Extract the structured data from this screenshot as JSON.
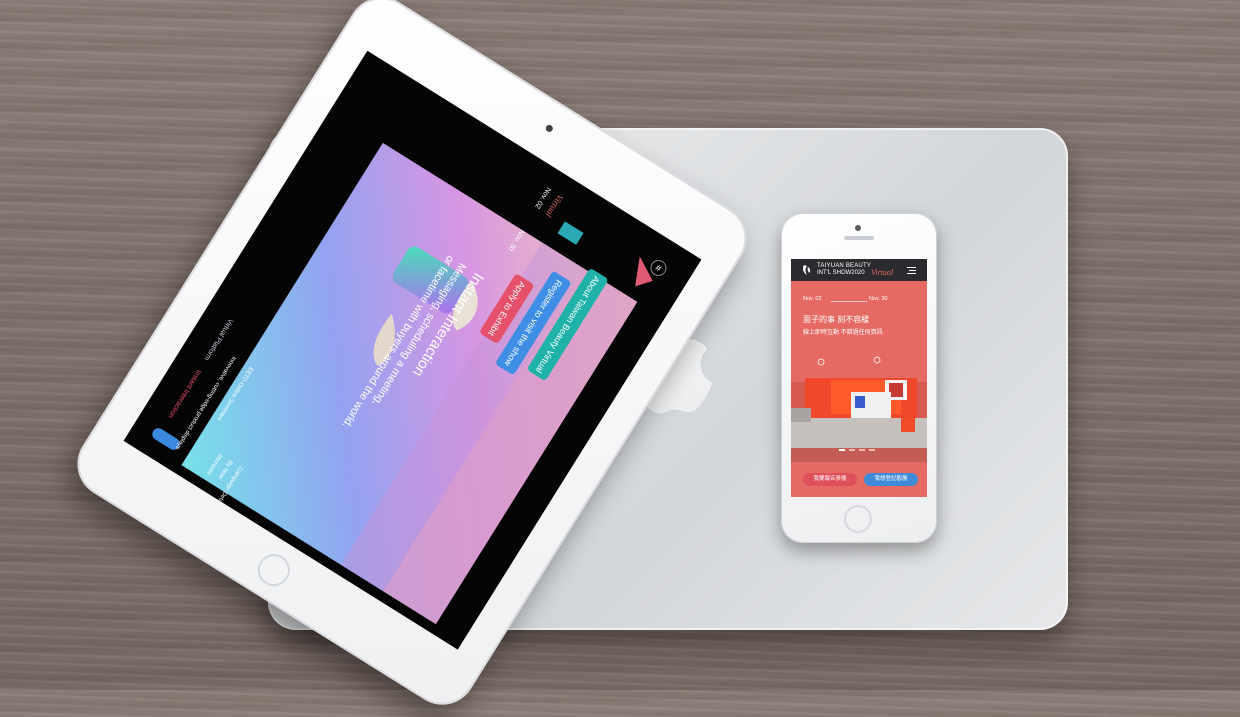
{
  "phone": {
    "brand_line1": "TAIYUAN BEAUTY",
    "brand_line2": "INT'L SHOW2020",
    "brand_virtual": "Virtual",
    "date_start": "Nov. 02",
    "date_end": "Nov. 30",
    "headline": "面子的事 刻不容緩",
    "subline": "線上即時互動 不錯過任何資訊",
    "button_register_exhibit": "我要報名參展",
    "button_register_visit": "我想登記觀展",
    "accent_color": "#e66a64"
  },
  "tablet": {
    "brand_virtual": "Virtual",
    "date_start": "Nov. 02",
    "date_end": "Nov. 30",
    "title": "Instant Interaction",
    "body_line1": "Messaging, scheduling a meeting,",
    "body_line2": "or facetime with buyers around the world.",
    "button_apply": "Apply to Exhibit",
    "button_register": "Register to visit the show",
    "button_about": "About Taiwan Beauty Virtual",
    "menu_virtual_platform": "Virtual Platform",
    "menu_instant_interaction": "Instant Interaction",
    "menu_innovative": "Innovative, cutting-edge product displays",
    "menu_eetd": "EETD Online Seminars",
    "menu_more1": "Microsite",
    "menu_more2": "By Now",
    "menu_more3": "Campaign Details",
    "hash_icon": "#"
  },
  "laptop": {
    "logo": "apple-logo-icon"
  }
}
